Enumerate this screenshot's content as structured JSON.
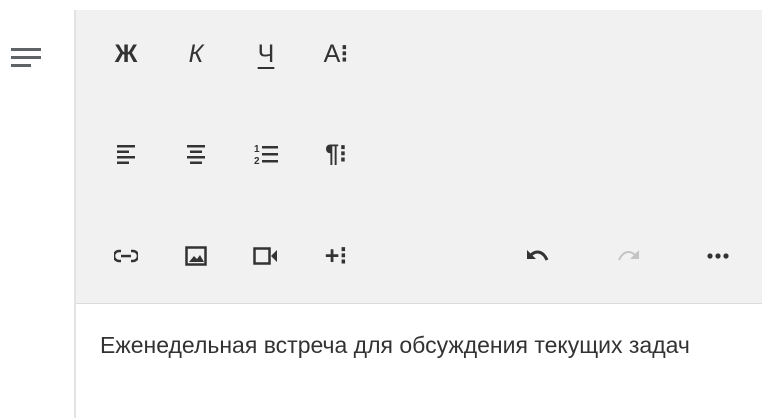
{
  "side": {
    "icon": "subject-lines-icon"
  },
  "toolbar": {
    "bold_label": "Ж",
    "italic_label": "К",
    "underline_label": "Ч",
    "font_menu_label": "А",
    "paragraph_menu_label": "¶",
    "icons": {
      "bold": "bold-icon",
      "italic": "italic-icon",
      "underline": "underline-icon",
      "font_more": "text-format-more-icon",
      "align_left": "align-left-icon",
      "align_center": "align-center-icon",
      "numbered_list": "numbered-list-icon",
      "paragraph_more": "paragraph-more-icon",
      "link": "link-icon",
      "image": "image-icon",
      "video": "video-icon",
      "insert_more": "insert-more-icon",
      "undo": "undo-icon",
      "redo": "redo-icon",
      "more": "more-horizontal-icon"
    },
    "redo_enabled": false
  },
  "content": {
    "text": "Еженедельная встреча для обсуждения текущих задач"
  },
  "colors": {
    "toolbar_bg": "#f1f1f1",
    "icon": "#333333",
    "icon_disabled": "#c4c4c4",
    "text": "#333333",
    "border": "#e3e3e3"
  }
}
